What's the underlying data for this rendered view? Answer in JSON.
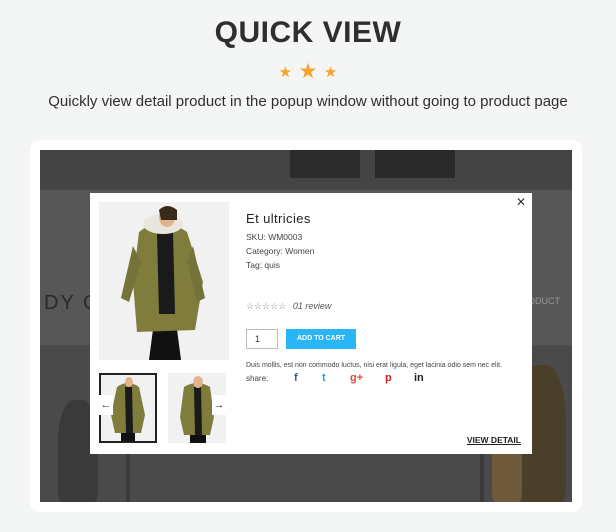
{
  "header": {
    "title": "QUICK VIEW",
    "subtitle": "Quickly view detail product in the popup window without going to product page",
    "stars": [
      "★",
      "★",
      "★"
    ],
    "star_color": "#f5a42a"
  },
  "background": {
    "heading_fragment": "DY C",
    "link_fragment": "ODUCT"
  },
  "modal": {
    "close_label": "✕",
    "product": {
      "name": "Et ultricies",
      "sku": "SKU: WM0003",
      "category": "Category: Women",
      "tag": "Tag: quis",
      "rating_stars": "☆☆☆☆☆",
      "review_text": "01 review",
      "quantity": "1",
      "add_to_cart_label": "ADD TO CART",
      "description": "Duis mollis, est non commodo luctus, nisi erat ligula, eget lacinia odio sem nec elit.",
      "share_label": "share:",
      "share_icons": [
        "f",
        "t",
        "g+",
        "p",
        "in"
      ],
      "view_detail_label": "VIEW DETAIL"
    },
    "thumb_prev": "←",
    "thumb_next": "→",
    "accent_color": "#29b6f6"
  }
}
